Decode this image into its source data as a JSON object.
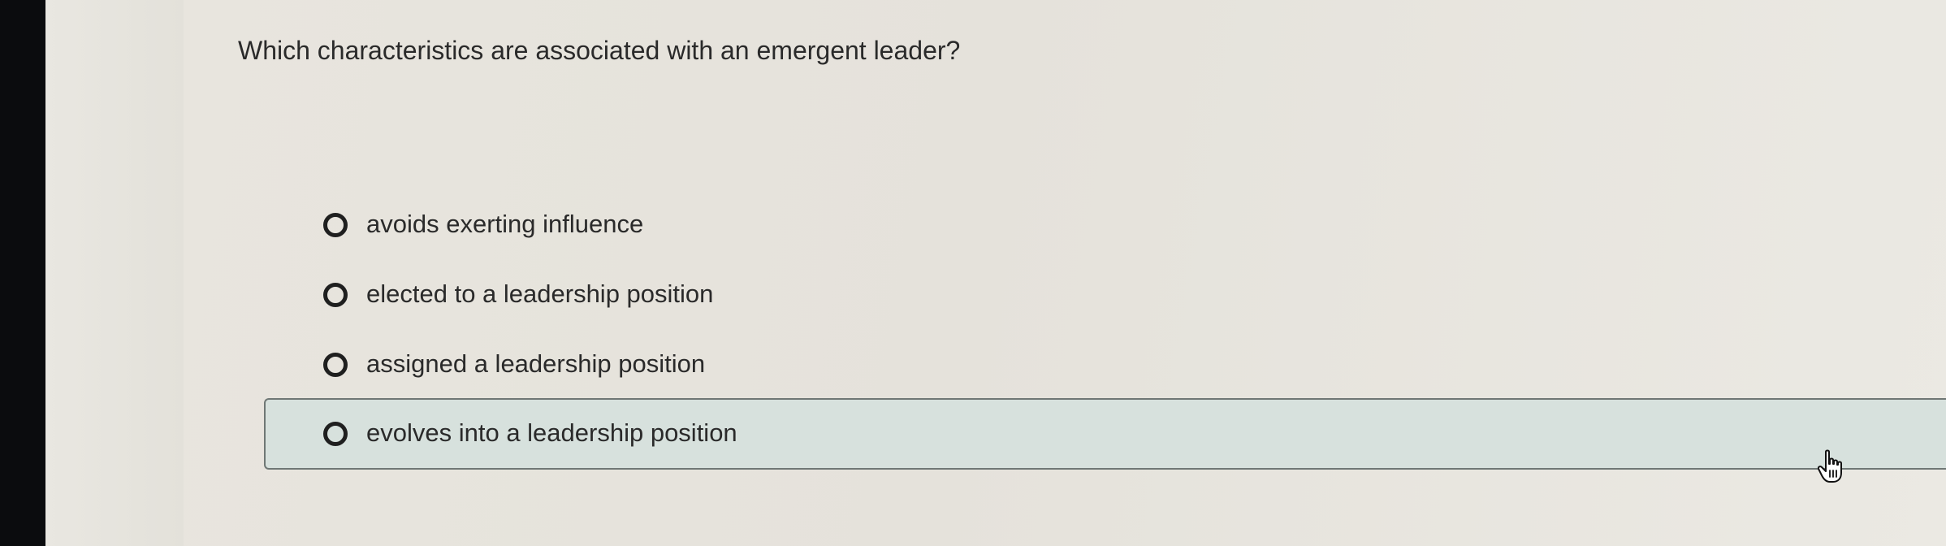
{
  "question": {
    "text": "Which characteristics are associated with an emergent leader?"
  },
  "options": [
    {
      "label": "avoids exerting influence",
      "selected": false,
      "highlighted": false
    },
    {
      "label": "elected to a leadership position",
      "selected": false,
      "highlighted": false
    },
    {
      "label": "assigned a leadership position",
      "selected": false,
      "highlighted": false
    },
    {
      "label": "evolves into a leadership position",
      "selected": false,
      "highlighted": true
    }
  ],
  "cursor": {
    "icon": "hand-pointer-icon"
  }
}
